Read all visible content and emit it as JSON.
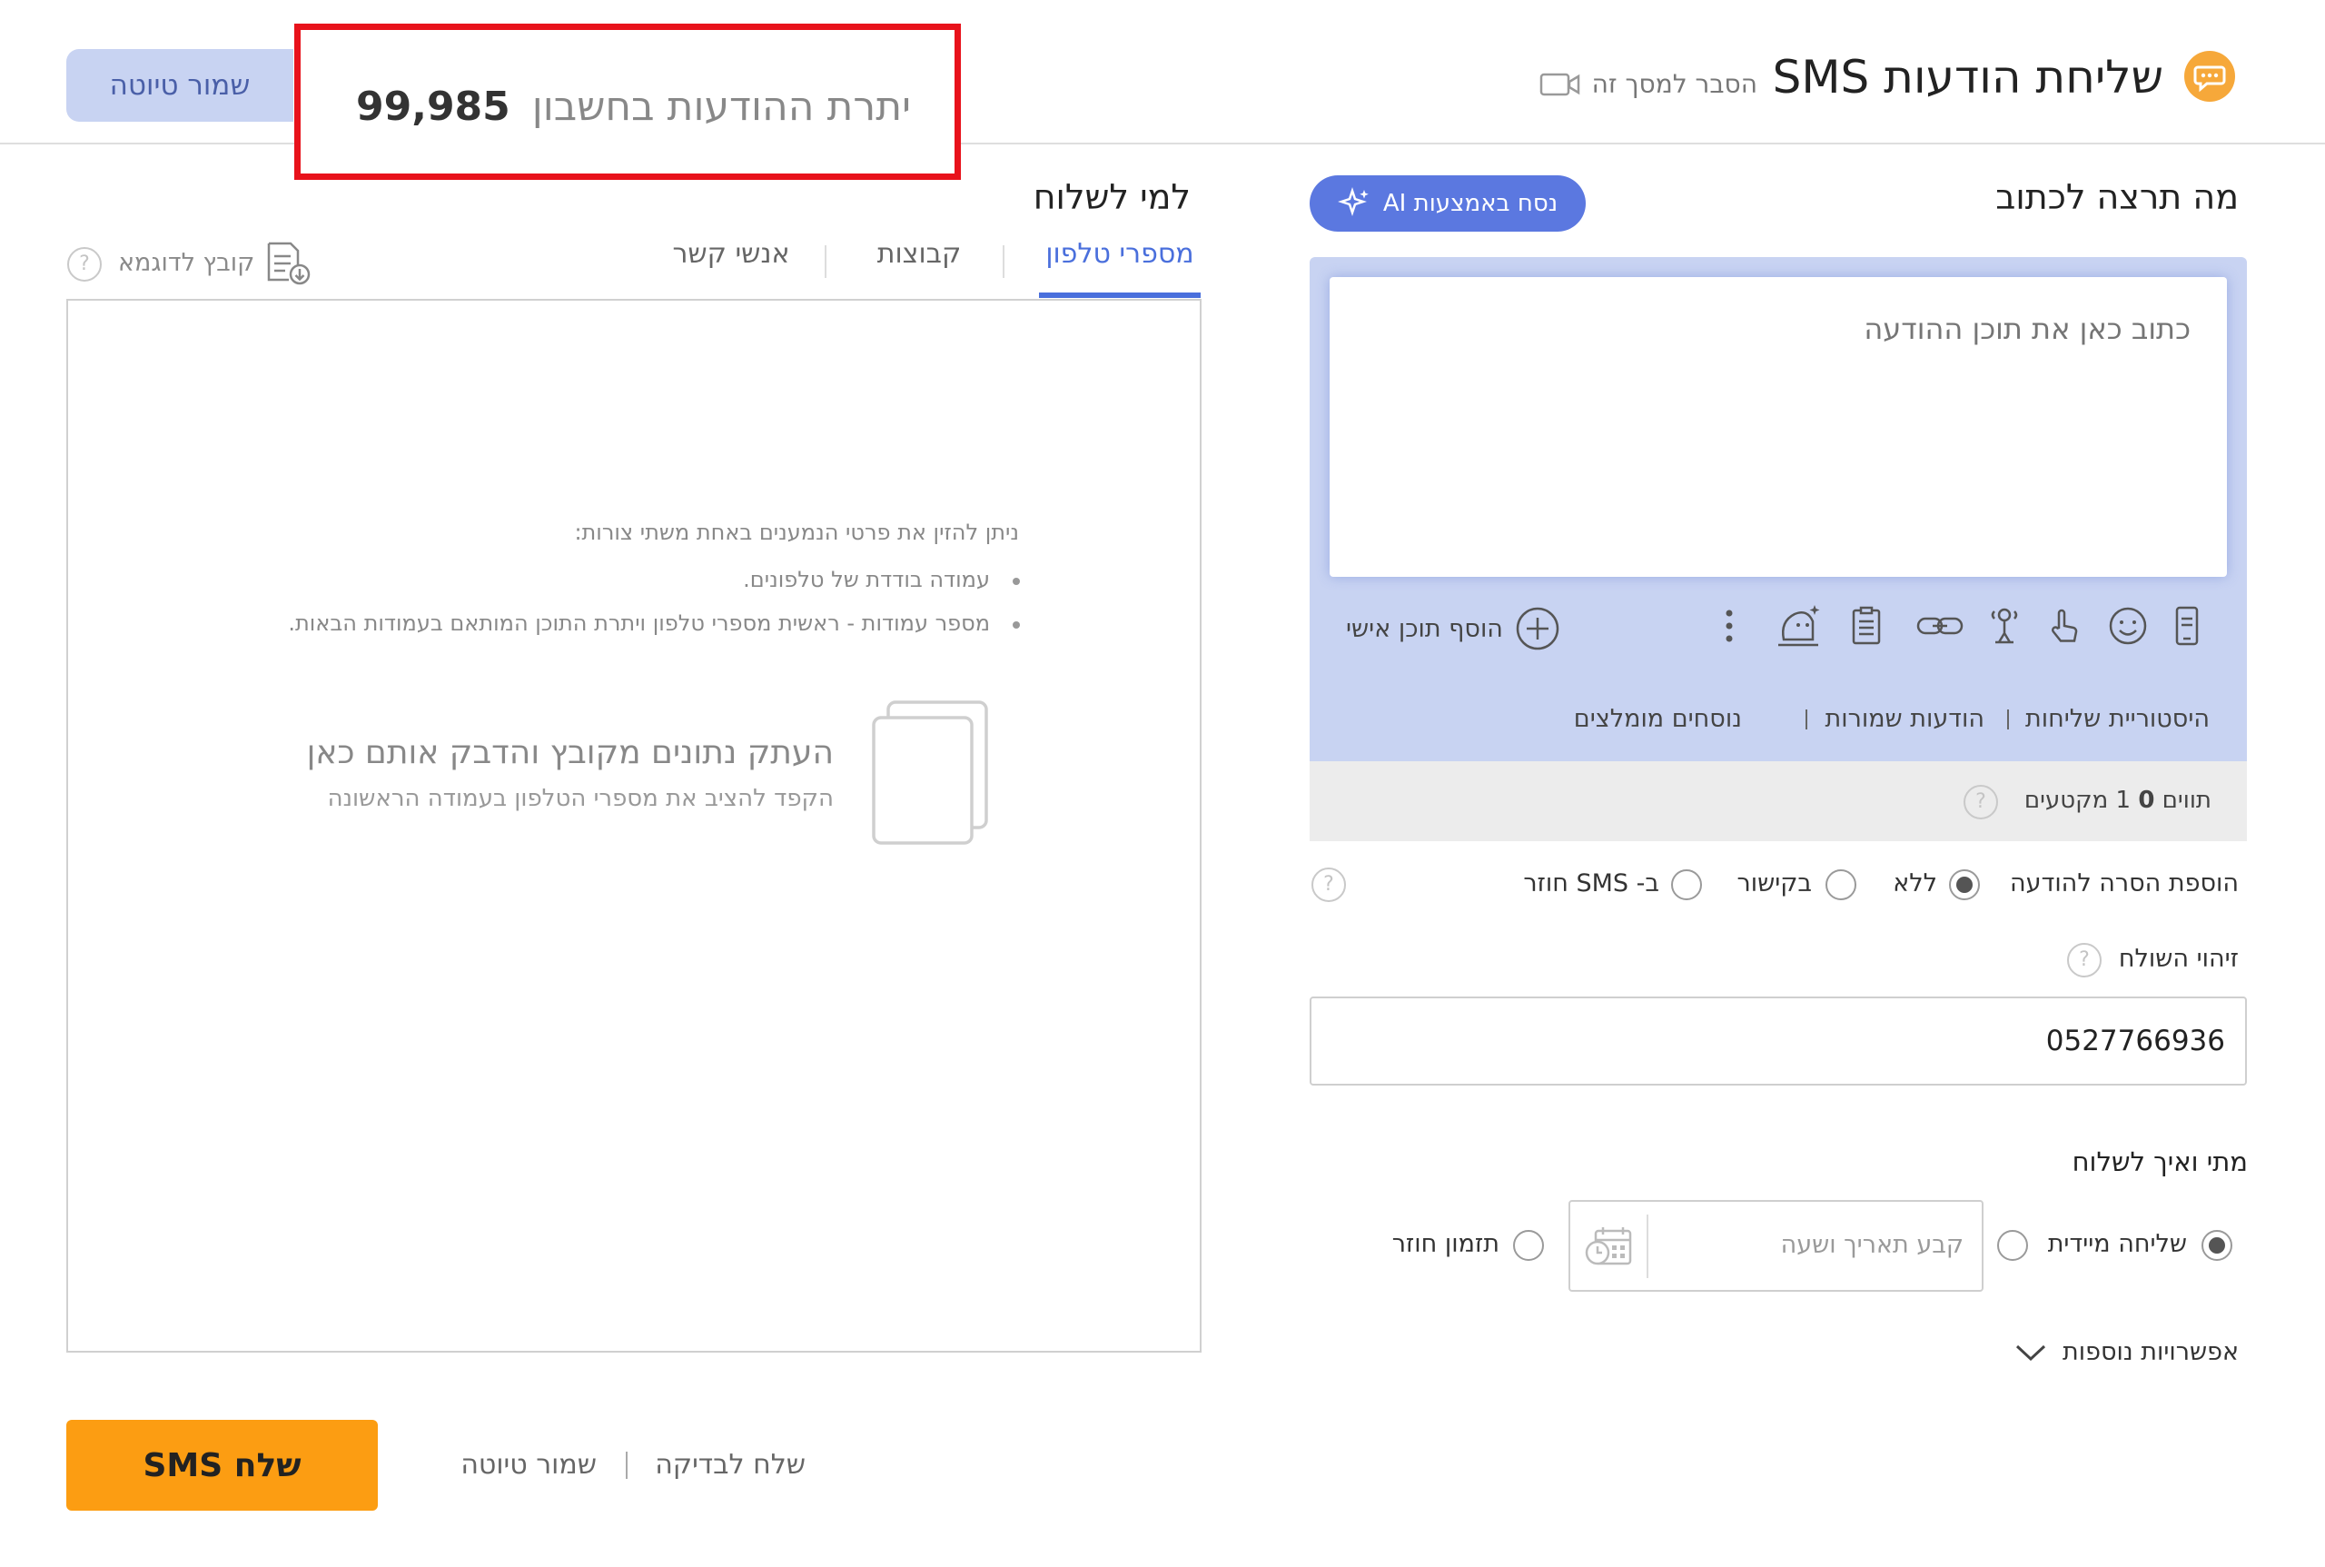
{
  "header": {
    "title": "שליחת הודעות SMS",
    "explain_link": "הסבר למסך זה",
    "balance_label": "יתרת ההודעות בחשבון",
    "balance_value": "99,985",
    "save_draft": "שמור טיוטה"
  },
  "compose": {
    "heading": "מה תרצה לכתוב",
    "ai_button": "נסח באמצעות AI",
    "textarea_placeholder": "כתוב כאן את תוכן ההודעה",
    "add_personal": "הוסף תוכן אישי",
    "links": [
      "היסטוריית שליחות",
      "הודעות שמורות",
      "נוסחים מומלצים"
    ],
    "counter": {
      "chars_prefix": "תווים",
      "chars": "0",
      "segments": "1",
      "segments_label": "מקטעים"
    },
    "removal": {
      "label": "הוספת הסרה להודעה",
      "options": [
        {
          "label": "ללא",
          "selected": true
        },
        {
          "label": "בקישור",
          "selected": false
        },
        {
          "label": "ב- SMS חוזר",
          "selected": false
        }
      ]
    },
    "sender": {
      "label": "זיהוי השולח",
      "value": "0527766936"
    },
    "when": {
      "heading": "מתי ואיך לשלוח",
      "immediate": "שליחה מיידית",
      "immediate_selected": true,
      "date_placeholder": "קבע תאריך ושעה",
      "recurring": "תזמון חוזר",
      "recurring_selected": false
    },
    "more_options": "אפשרויות נוספות"
  },
  "recipients": {
    "heading": "למי לשלוח",
    "tabs": [
      {
        "label": "מספרי טלפון",
        "active": true
      },
      {
        "label": "קבוצות",
        "active": false
      },
      {
        "label": "אנשי קשר",
        "active": false
      }
    ],
    "sample_file": "קובץ לדוגמא",
    "instructions": "ניתן להזין את פרטי הנמענים באחת משתי צורות:",
    "bullets": [
      "עמודה בודדת של טלפונים.",
      "מספר עמודות - ראשית מספרי טלפון ויתרת התוכן המותאם בעמודות הבאות."
    ],
    "paste_title": "העתק נתונים מקובץ והדבק אותם כאן",
    "paste_subtitle": "הקפד להציב את מספרי הטלפון בעמודה הראשונה"
  },
  "footer": {
    "send_button": "שלח SMS",
    "save_draft": "שמור טיוטה",
    "send_test": "שלח לבדיקה"
  },
  "colors": {
    "accent": "#4a6fdc",
    "ai_button": "#5b78e0",
    "panel": "#c8d3f2",
    "send": "#fc9d12",
    "highlight": "#e8121b"
  }
}
